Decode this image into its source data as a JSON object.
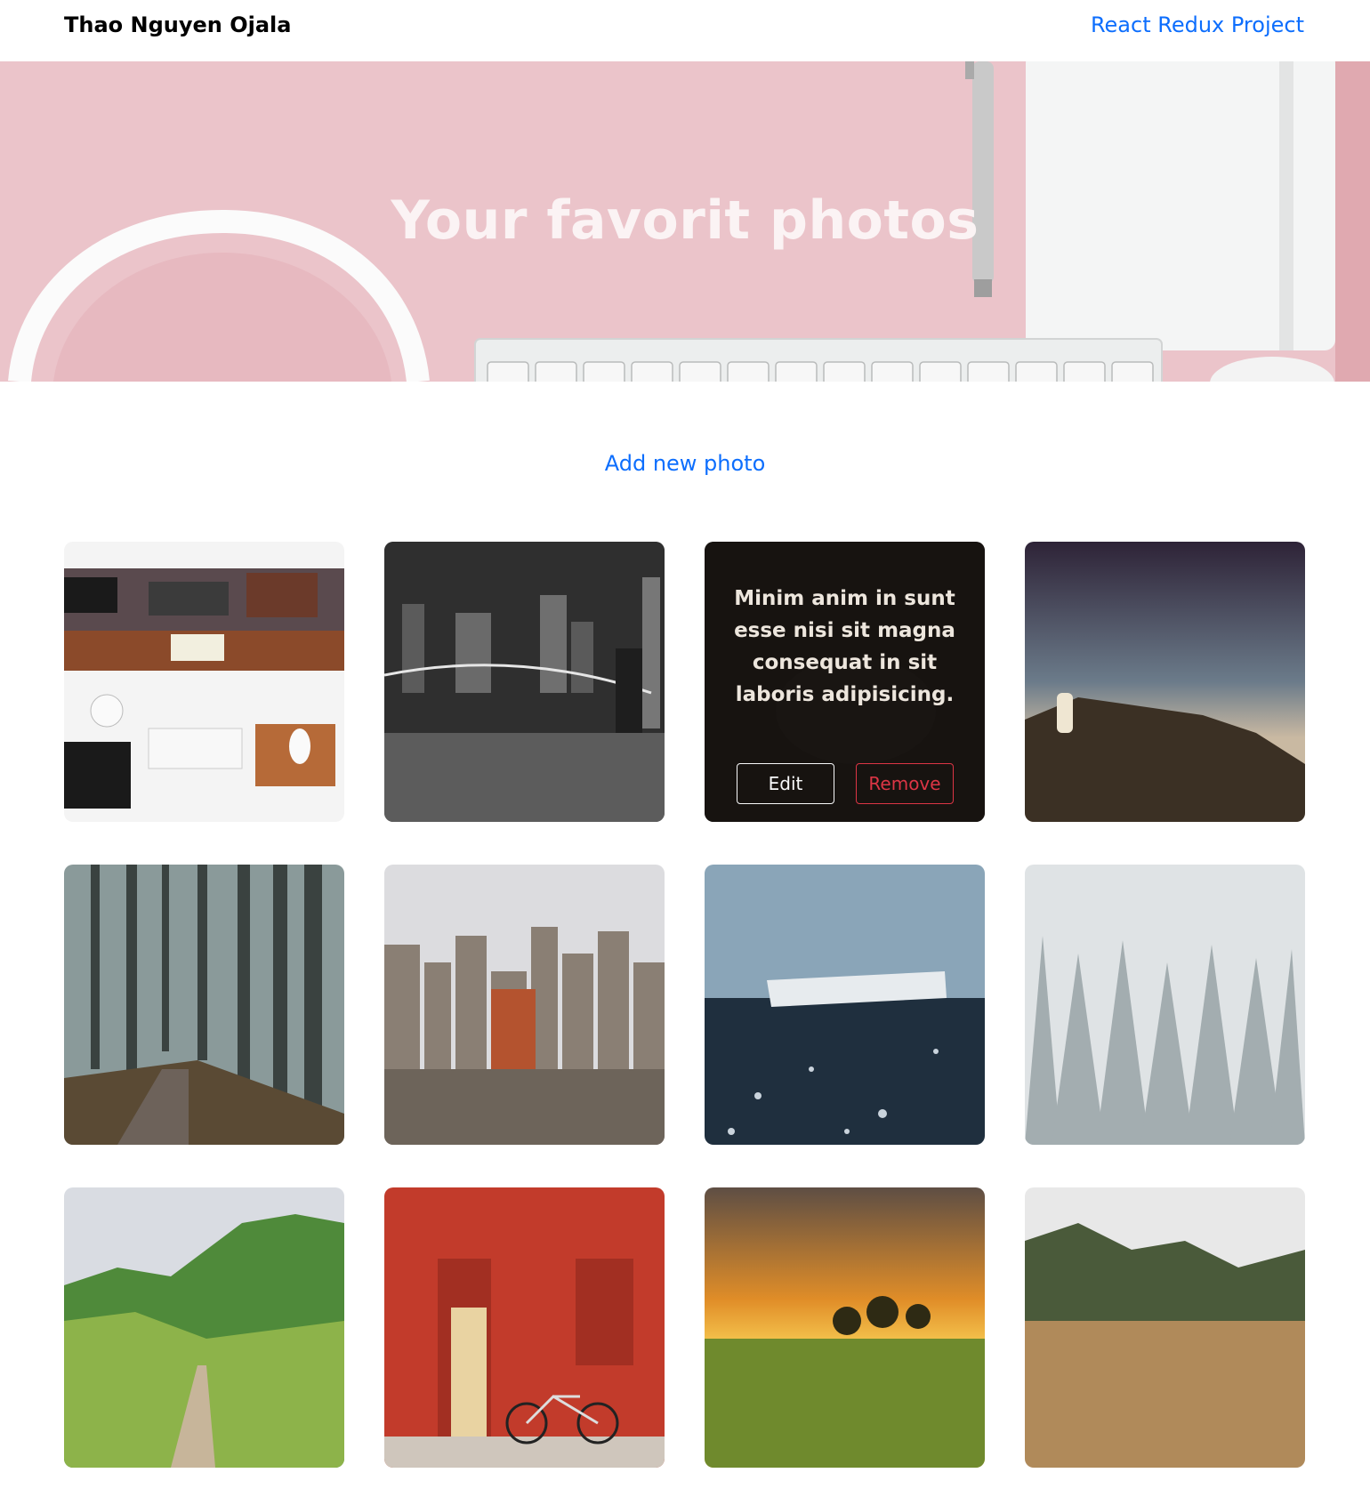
{
  "header": {
    "brand": "Thao Nguyen Ojala",
    "nav_link": "React Redux Project"
  },
  "hero": {
    "title": "Your favorit photos"
  },
  "actions": {
    "add_photo": "Add new photo"
  },
  "gallery": {
    "photos": [
      {
        "subject": "desk workspace top view",
        "hovered": false
      },
      {
        "subject": "bridge city night black and white",
        "hovered": false
      },
      {
        "subject": "dark photo with caption overlay",
        "hovered": true,
        "caption": "Minim anim in sunt esse nisi sit magna consequat in sit laboris adipisicing.",
        "edit_label": "Edit",
        "remove_label": "Remove"
      },
      {
        "subject": "person on rocky cliff at dusk",
        "hovered": false
      },
      {
        "subject": "foggy forest path",
        "hovered": false
      },
      {
        "subject": "city skyline buildings",
        "hovered": false
      },
      {
        "subject": "plane wreck on black beach",
        "hovered": false
      },
      {
        "subject": "snowy pine forest in fog",
        "hovered": false
      },
      {
        "subject": "green mountain valley",
        "hovered": false
      },
      {
        "subject": "red brick wall with door and bicycle",
        "hovered": false
      },
      {
        "subject": "sunset over grassy field",
        "hovered": false
      },
      {
        "subject": "dry grass field with trees",
        "hovered": false
      }
    ]
  },
  "colors": {
    "link": "#0d6efd",
    "danger": "#dc3545",
    "hero_bg": "#ecc6cc"
  }
}
